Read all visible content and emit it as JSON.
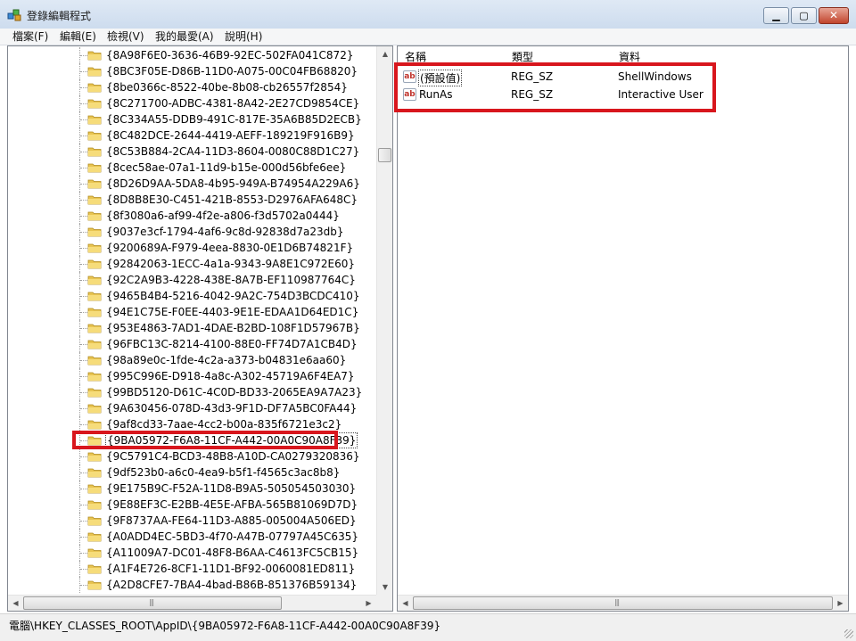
{
  "window": {
    "title": "登錄編輯程式",
    "icon": "regedit-icon",
    "buttons": {
      "minimize": "minimize-icon",
      "maximize": "maximize-icon",
      "close": "close-icon"
    }
  },
  "menu": [
    {
      "label": "檔案(F)"
    },
    {
      "label": "編輯(E)"
    },
    {
      "label": "檢視(V)"
    },
    {
      "label": "我的最愛(A)"
    },
    {
      "label": "說明(H)"
    }
  ],
  "tree": {
    "items": [
      {
        "label": "{8A98F6E0-3636-46B9-92EC-502FA041C872}"
      },
      {
        "label": "{8BC3F05E-D86B-11D0-A075-00C04FB68820}"
      },
      {
        "label": "{8be0366c-8522-40be-8b08-cb26557f2854}"
      },
      {
        "label": "{8C271700-ADBC-4381-8A42-2E27CD9854CE}"
      },
      {
        "label": "{8C334A55-DDB9-491C-817E-35A6B85D2ECB}"
      },
      {
        "label": "{8C482DCE-2644-4419-AEFF-189219F916B9}"
      },
      {
        "label": "{8C53B884-2CA4-11D3-8604-0080C88D1C27}"
      },
      {
        "label": "{8cec58ae-07a1-11d9-b15e-000d56bfe6ee}"
      },
      {
        "label": "{8D26D9AA-5DA8-4b95-949A-B74954A229A6}"
      },
      {
        "label": "{8D8B8E30-C451-421B-8553-D2976AFA648C}"
      },
      {
        "label": "{8f3080a6-af99-4f2e-a806-f3d5702a0444}"
      },
      {
        "label": "{9037e3cf-1794-4af6-9c8d-92838d7a23db}"
      },
      {
        "label": "{9200689A-F979-4eea-8830-0E1D6B74821F}"
      },
      {
        "label": "{92842063-1ECC-4a1a-9343-9A8E1C972E60}"
      },
      {
        "label": "{92C2A9B3-4228-438E-8A7B-EF110987764C}"
      },
      {
        "label": "{9465B4B4-5216-4042-9A2C-754D3BCDC410}"
      },
      {
        "label": "{94E1C75E-F0EE-4403-9E1E-EDAA1D64ED1C}"
      },
      {
        "label": "{953E4863-7AD1-4DAE-B2BD-108F1D57967B}"
      },
      {
        "label": "{96FBC13C-8214-4100-88E0-FF74D7A1CB4D}"
      },
      {
        "label": "{98a89e0c-1fde-4c2a-a373-b04831e6aa60}"
      },
      {
        "label": "{995C996E-D918-4a8c-A302-45719A6F4EA7}"
      },
      {
        "label": "{99BD5120-D61C-4C0D-BD33-2065EA9A7A23}"
      },
      {
        "label": "{9A630456-078D-43d3-9F1D-DF7A5BC0FA44}"
      },
      {
        "label": "{9af8cd33-7aae-4cc2-b00a-835f6721e3c2}"
      },
      {
        "label": "{9BA05972-F6A8-11CF-A442-00A0C90A8F39}",
        "selected": true
      },
      {
        "label": "{9C5791C4-BCD3-48B8-A10D-CA0279320836}"
      },
      {
        "label": "{9df523b0-a6c0-4ea9-b5f1-f4565c3ac8b8}"
      },
      {
        "label": "{9E175B9C-F52A-11D8-B9A5-505054503030}"
      },
      {
        "label": "{9E88EF3C-E2BB-4E5E-AFBA-565B81069D7D}"
      },
      {
        "label": "{9F8737AA-FE64-11D3-A885-005004A506ED}"
      },
      {
        "label": "{A0ADD4EC-5BD3-4f70-A47B-07797A45C635}"
      },
      {
        "label": "{A11009A7-DC01-48F8-B6AA-C4613FC5CB15}"
      },
      {
        "label": "{A1F4E726-8CF1-11D1-BF92-0060081ED811}"
      },
      {
        "label": "{A2D8CFE7-7BA4-4bad-B86B-851376B59134}"
      }
    ]
  },
  "values": {
    "columns": {
      "name": "名稱",
      "type": "類型",
      "data": "資料"
    },
    "rows": [
      {
        "name": "(預設值)",
        "type": "REG_SZ",
        "data": "ShellWindows",
        "icon": "string-value-icon"
      },
      {
        "name": "RunAs",
        "type": "REG_SZ",
        "data": "Interactive User",
        "icon": "string-value-icon"
      }
    ]
  },
  "status": {
    "path": "電腦\\HKEY_CLASSES_ROOT\\AppID\\{9BA05972-F6A8-11CF-A442-00A0C90A8F39}"
  },
  "colors": {
    "highlight": "#d8161d",
    "folder": "#e8c451"
  }
}
